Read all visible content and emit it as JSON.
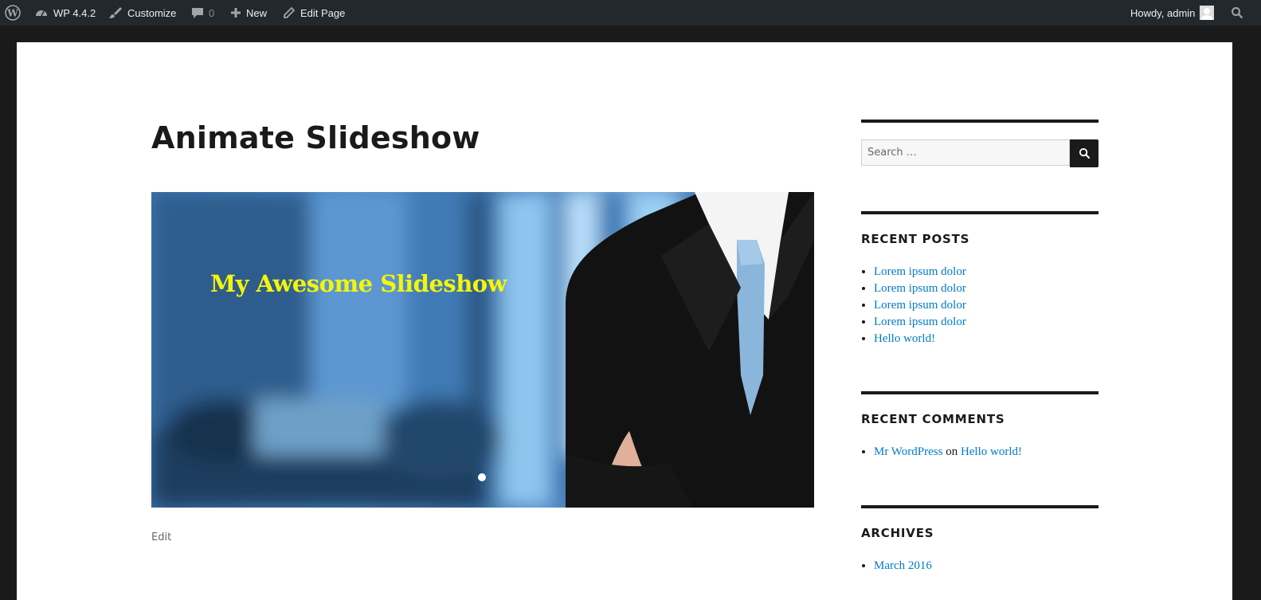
{
  "adminbar": {
    "wp_logo_icon": "wordpress-icon",
    "site_label": "WP 4.4.2",
    "customize_label": "Customize",
    "comments_count": "0",
    "new_label": "New",
    "edit_page_label": "Edit Page",
    "howdy_label": "Howdy, admin"
  },
  "page": {
    "title": "Animate Slideshow",
    "slide_caption": "My Awesome Slideshow",
    "edit_label": "Edit"
  },
  "sidebar": {
    "search_placeholder": "Search …",
    "recent_posts_title": "RECENT POSTS",
    "recent_posts": [
      "Lorem ipsum dolor",
      "Lorem ipsum dolor",
      "Lorem ipsum dolor",
      "Lorem ipsum dolor",
      "Hello world!"
    ],
    "recent_comments_title": "RECENT COMMENTS",
    "recent_comment": {
      "author": "Mr WordPress",
      "on": "on",
      "post": "Hello world!"
    },
    "archives_title": "ARCHIVES",
    "archives": [
      "March 2016"
    ]
  },
  "colors": {
    "adminbar_bg": "#23282d",
    "link": "#007acc",
    "caption": "#f5f50b"
  }
}
